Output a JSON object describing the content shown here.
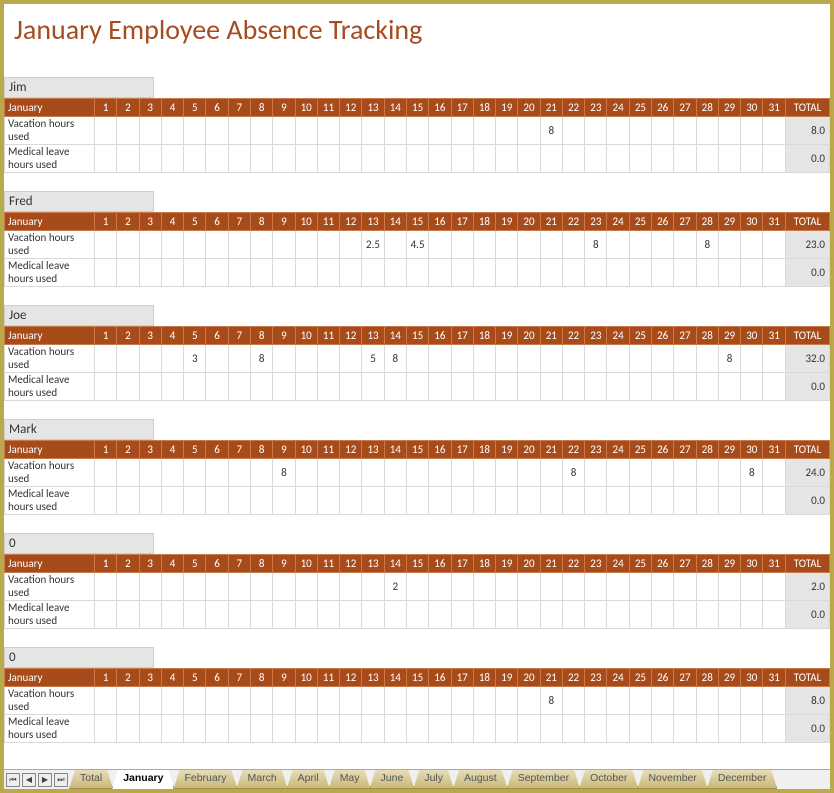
{
  "title": "January Employee Absence Tracking",
  "monthLabel": "January",
  "totalLabel": "TOTAL",
  "rowLabels": {
    "vacation": "Vacation hours used",
    "medical": "Medical leave hours used"
  },
  "employees": [
    {
      "name": "Jim",
      "vacation": {
        "days": {
          "21": "8"
        },
        "total": "8.0"
      },
      "medical": {
        "days": {},
        "total": "0.0"
      }
    },
    {
      "name": "Fred",
      "vacation": {
        "days": {
          "13": "2.5",
          "15": "4.5",
          "23": "8",
          "28": "8"
        },
        "total": "23.0"
      },
      "medical": {
        "days": {},
        "total": "0.0"
      }
    },
    {
      "name": "Joe",
      "vacation": {
        "days": {
          "5": "3",
          "8": "8",
          "13": "5",
          "14": "8",
          "29": "8"
        },
        "total": "32.0"
      },
      "medical": {
        "days": {},
        "total": "0.0"
      }
    },
    {
      "name": "Mark",
      "vacation": {
        "days": {
          "9": "8",
          "22": "8",
          "30": "8"
        },
        "total": "24.0"
      },
      "medical": {
        "days": {},
        "total": "0.0"
      }
    },
    {
      "name": "0",
      "vacation": {
        "days": {
          "14": "2"
        },
        "total": "2.0"
      },
      "medical": {
        "days": {},
        "total": "0.0"
      }
    },
    {
      "name": "0",
      "vacation": {
        "days": {
          "21": "8"
        },
        "total": "8.0"
      },
      "medical": {
        "days": {},
        "total": "0.0"
      }
    }
  ],
  "tabs": {
    "items": [
      "Total",
      "January",
      "February",
      "March",
      "April",
      "May",
      "June",
      "July",
      "August",
      "September",
      "October",
      "November",
      "December"
    ],
    "active": "January"
  }
}
